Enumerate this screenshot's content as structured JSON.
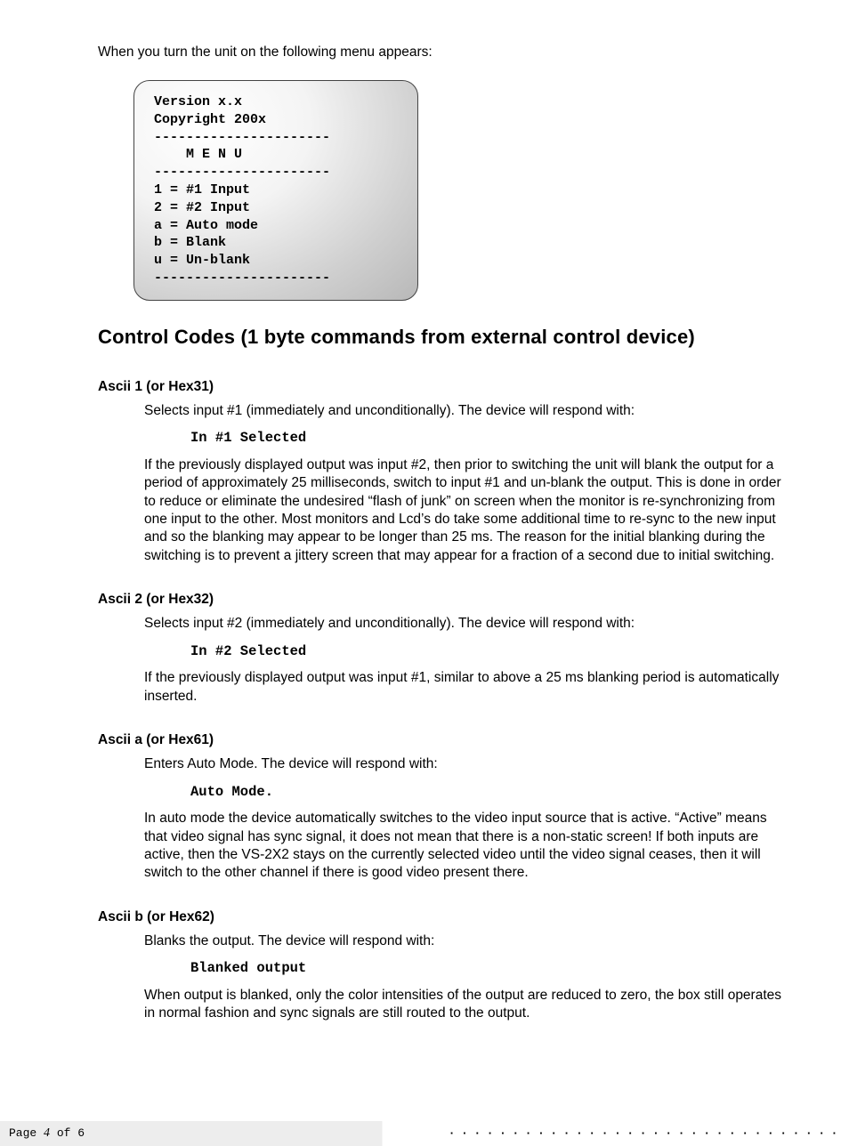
{
  "intro": "When you turn the unit on the following menu appears:",
  "menu_box": "Version x.x\nCopyright 200x\n----------------------\n    M E N U\n----------------------\n1 = #1 Input\n2 = #2 Input\na = Auto mode\nb = Blank\nu = Un-blank\n----------------------",
  "section_title": "Control Codes (1 byte commands from external control device)",
  "entries": {
    "e1": {
      "title": "Ascii 1 (or Hex31)",
      "p1": "Selects input #1 (immediately and unconditionally). The device will respond with:",
      "code": "In #1 Selected",
      "p2": "If the previously displayed output was input #2, then prior to switching the unit will blank the output for a period of approximately 25 milliseconds, switch to input #1 and un-blank the output. This is done in order to reduce or eliminate the undesired “flash of junk” on screen when the monitor is re-synchronizing from one input to the other. Most monitors and Lcd’s do take some additional time to re-sync to the new input and so the blanking may appear to be longer than 25 ms. The reason for the initial blanking during the switching is to prevent a jittery screen that may appear for a fraction of a second due to initial switching."
    },
    "e2": {
      "title": "Ascii 2 (or Hex32)",
      "p1": "Selects input #2 (immediately and unconditionally). The device will respond with:",
      "code": "In #2 Selected",
      "p2": "If the previously displayed output was input #1, similar to above a 25 ms blanking period is automatically inserted."
    },
    "e3": {
      "title": "Ascii a (or Hex61)",
      "p1": "Enters Auto Mode. The device will respond with:",
      "code": "Auto Mode.",
      "p2": "In auto mode the device automatically switches to the video input source that is active. “Active” means that video signal has sync signal, it does not mean that there is a non-static screen! If both inputs are active, then the VS-2X2 stays on the currently selected video until the video signal ceases, then it will switch to the other channel if there is good video present there."
    },
    "e4": {
      "title": "Ascii b (or Hex62)",
      "p1": "Blanks the output. The device will respond with:",
      "code": "Blanked output",
      "p2": "When output is blanked, only the color intensities of the output are reduced to zero, the box still operates in normal fashion and sync signals are still routed to the output."
    }
  },
  "footer": {
    "page_prefix": "Page ",
    "page_current": "4",
    "page_suffix": " of 6"
  }
}
